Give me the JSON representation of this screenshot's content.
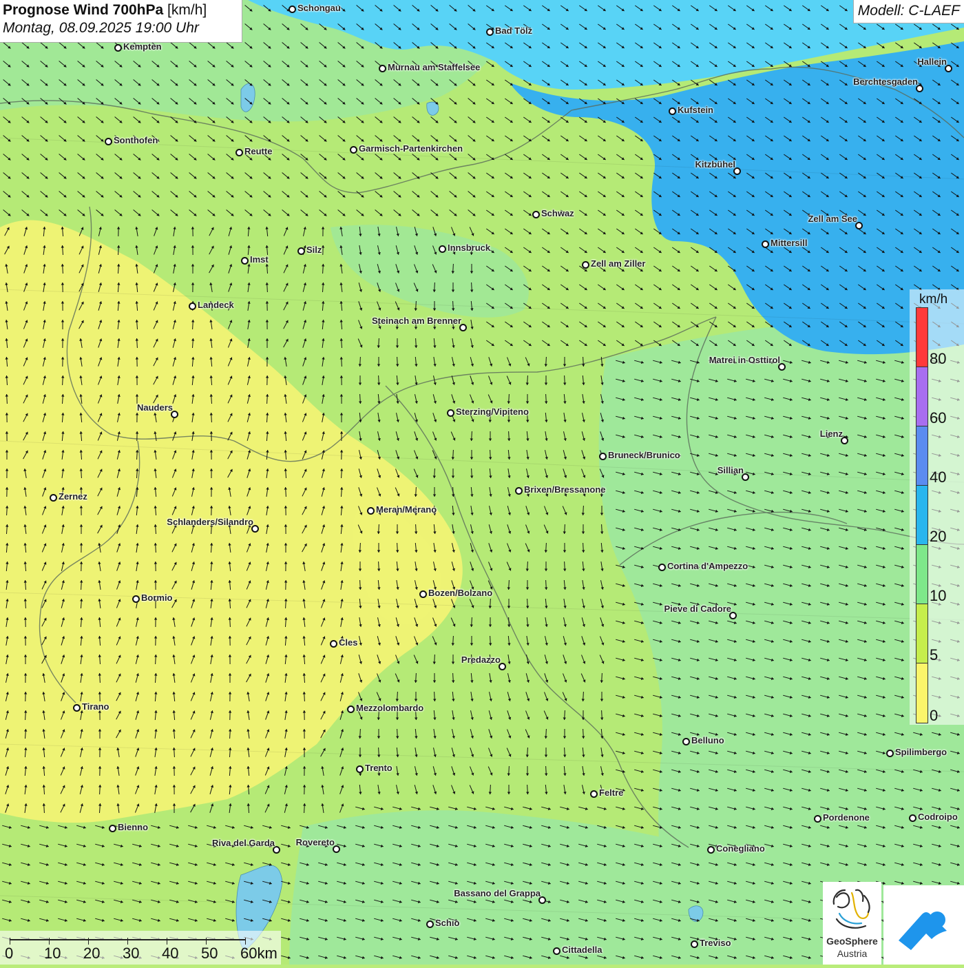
{
  "header": {
    "title_bold": "Prognose Wind 700hPa",
    "title_unit": " [km/h]",
    "datetime": "Montag, 08.09.2025 19:00 Uhr"
  },
  "model": "Modell: C-LAEF",
  "legend": {
    "unit": "km/h",
    "labels": [
      "80",
      "60",
      "40",
      "20",
      "10",
      "5",
      "0"
    ],
    "colors": [
      "#ff3a3a",
      "#a86ef0",
      "#5b8cf0",
      "#29b6ee",
      "#7ee88a",
      "#c6ee4c",
      "#fbf56a"
    ]
  },
  "scale": {
    "labels": [
      "0",
      "10",
      "20",
      "30",
      "40",
      "50",
      "60km"
    ]
  },
  "cities": [
    {
      "name": "Schongau"
    },
    {
      "name": "Kempten"
    },
    {
      "name": "Bad Tölz"
    },
    {
      "name": "Murnau am Staffelsee"
    },
    {
      "name": "Hallein"
    },
    {
      "name": "Berchtesgaden"
    },
    {
      "name": "Kufstein"
    },
    {
      "name": "Sonthofen"
    },
    {
      "name": "Reutte"
    },
    {
      "name": "Garmisch-Partenkirchen"
    },
    {
      "name": "Kitzbühel"
    },
    {
      "name": "Schwaz"
    },
    {
      "name": "Zell am See"
    },
    {
      "name": "Mittersill"
    },
    {
      "name": "Innsbruck"
    },
    {
      "name": "Silz"
    },
    {
      "name": "Imst"
    },
    {
      "name": "Zell am Ziller"
    },
    {
      "name": "Landeck"
    },
    {
      "name": "Steinach am Brenner"
    },
    {
      "name": "Matrei in Osttirol"
    },
    {
      "name": "Nauders"
    },
    {
      "name": "Sterzing/Vipiteno"
    },
    {
      "name": "Lienz"
    },
    {
      "name": "Bruneck/Brunico"
    },
    {
      "name": "Sillian"
    },
    {
      "name": "Brixen/Bressanone"
    },
    {
      "name": "Zernez"
    },
    {
      "name": "Meran/Merano"
    },
    {
      "name": "Schlanders/Silandro"
    },
    {
      "name": "Cortina d'Ampezzo"
    },
    {
      "name": "Bozen/Bolzano"
    },
    {
      "name": "Bormio"
    },
    {
      "name": "Pieve di Cadore"
    },
    {
      "name": "Cles"
    },
    {
      "name": "Predazzo"
    },
    {
      "name": "Tirano"
    },
    {
      "name": "Mezzolombardo"
    },
    {
      "name": "Belluno"
    },
    {
      "name": "Spilimbergo"
    },
    {
      "name": "Trento"
    },
    {
      "name": "Feltre"
    },
    {
      "name": "Bienno"
    },
    {
      "name": "Pordenone"
    },
    {
      "name": "Codroipo"
    },
    {
      "name": "Riva del Garda"
    },
    {
      "name": "Rovereto"
    },
    {
      "name": "Conegliano"
    },
    {
      "name": "Bassano del Grappa"
    },
    {
      "name": "Schio"
    },
    {
      "name": "Treviso"
    },
    {
      "name": "Cittadella"
    }
  ],
  "logo": {
    "line1": "GeoSphere",
    "line2": "Austria"
  }
}
